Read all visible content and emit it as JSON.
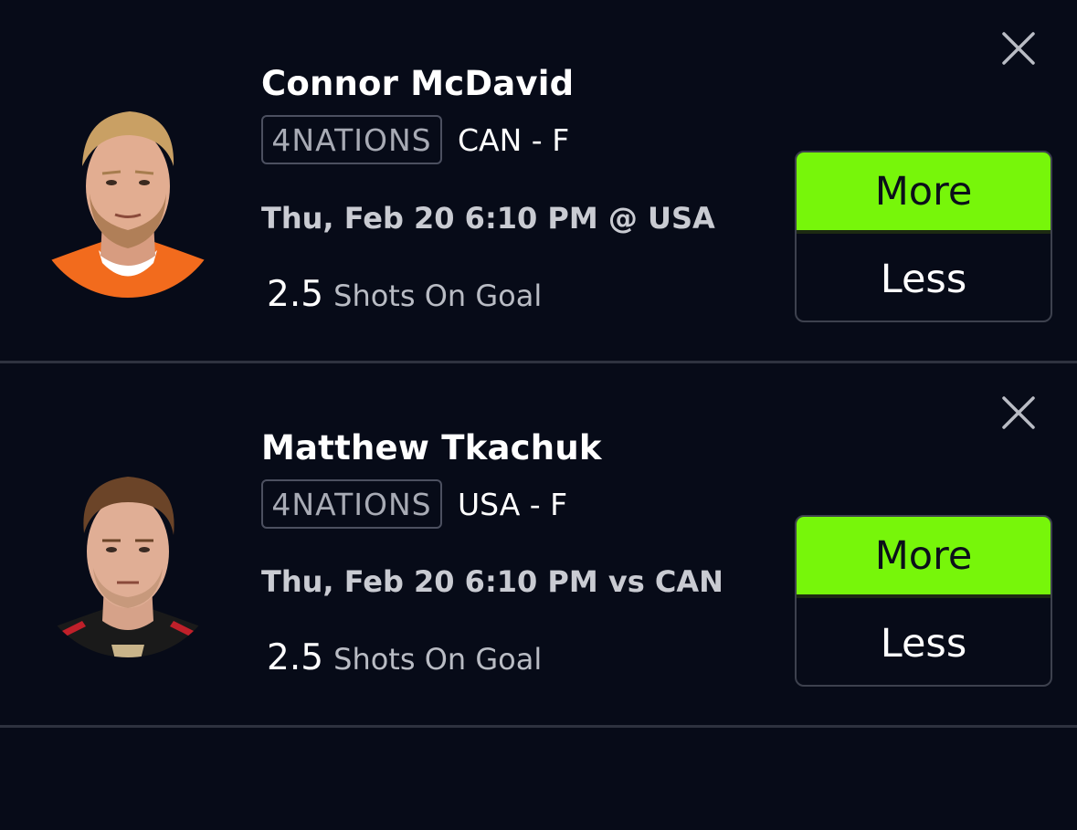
{
  "colors": {
    "background": "#070b18",
    "more_button": "#77f60a",
    "divider": "#2e323f",
    "badge_border": "#4c5060"
  },
  "picks": [
    {
      "player_name": "Connor McDavid",
      "league": "4NATIONS",
      "team_position": "CAN - F",
      "game_time": "Thu, Feb 20 6:10 PM @ USA",
      "line_value": "2.5",
      "stat_type": "Shots On Goal",
      "more_label": "More",
      "less_label": "Less",
      "more_selected": true,
      "close_icon": "close-icon",
      "jersey_color": "#f26b1d"
    },
    {
      "player_name": "Matthew Tkachuk",
      "league": "4NATIONS",
      "team_position": "USA - F",
      "game_time": "Thu, Feb 20 6:10 PM vs CAN",
      "line_value": "2.5",
      "stat_type": "Shots On Goal",
      "more_label": "More",
      "less_label": "Less",
      "more_selected": true,
      "close_icon": "close-icon",
      "jersey_color": "#1a1a1a"
    }
  ]
}
